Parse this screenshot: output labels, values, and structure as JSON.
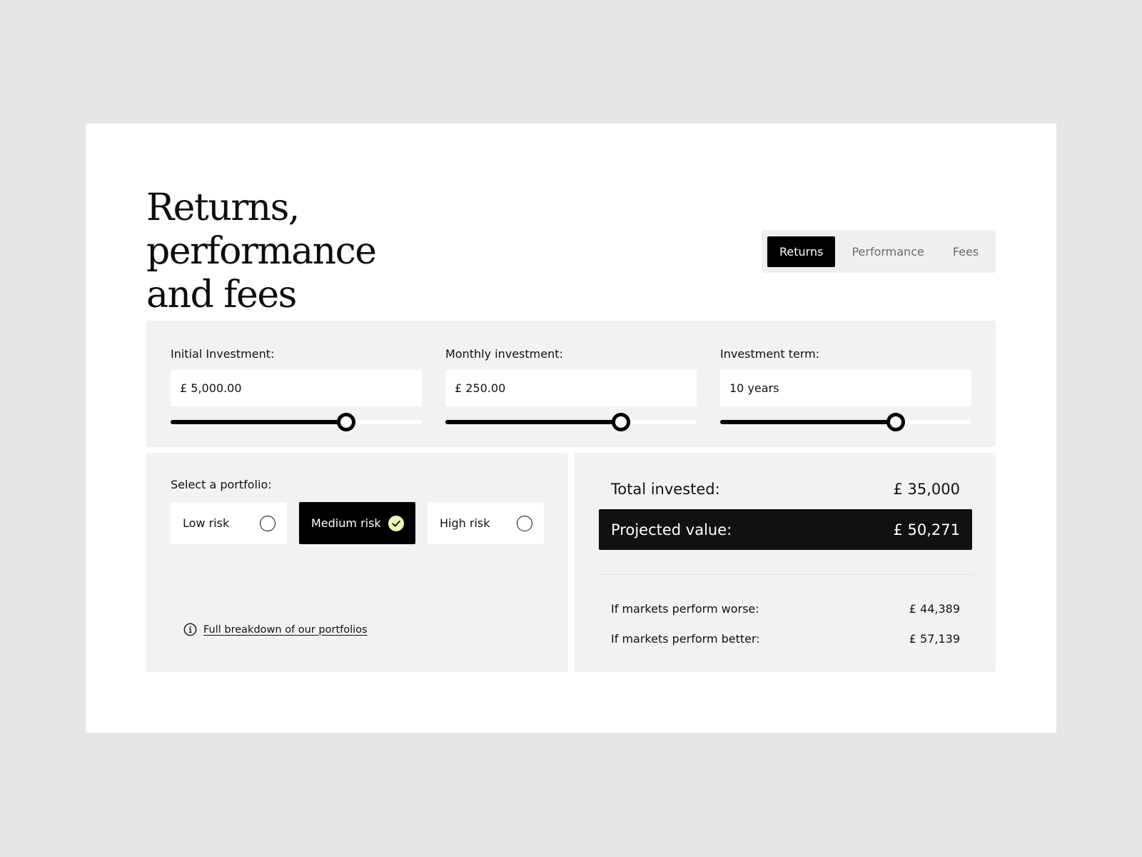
{
  "header": {
    "title_line1": "Returns, performance",
    "title_line2": "and fees"
  },
  "tabs": [
    {
      "label": "Returns",
      "active": true
    },
    {
      "label": "Performance",
      "active": false
    },
    {
      "label": "Fees",
      "active": false
    }
  ],
  "inputs": {
    "initial": {
      "label": "Initial Investment:",
      "value": "£ 5,000.00",
      "slider_fraction": 0.7
    },
    "monthly": {
      "label": "Monthly investment:",
      "value": "£ 250.00",
      "slider_fraction": 0.7
    },
    "term": {
      "label": "Investment term:",
      "value": "10 years",
      "slider_fraction": 0.7
    }
  },
  "portfolio": {
    "label": "Select a portfolio:",
    "options": [
      {
        "label": "Low risk",
        "selected": false
      },
      {
        "label": "Medium risk",
        "selected": true
      },
      {
        "label": "High risk",
        "selected": false
      }
    ],
    "breakdown_link": "Full breakdown of our portfolios"
  },
  "results": {
    "total_label": "Total invested:",
    "total_value": "£ 35,000",
    "projected_label": "Projected value:",
    "projected_value": "£ 50,271",
    "worse_label": "If markets perform worse:",
    "worse_value": "£ 44,389",
    "better_label": "If markets perform better:",
    "better_value": "£ 57,139"
  },
  "colors": {
    "background": "#e5e6e8",
    "card": "#ffffff",
    "panel": "#f2f2f2",
    "accent_dark": "#000000",
    "check_accent": "#eef5b8"
  },
  "icons": {
    "selected_option": "check-circle-icon",
    "unselected_option": "radio-empty-icon",
    "breakdown": "info-icon"
  }
}
